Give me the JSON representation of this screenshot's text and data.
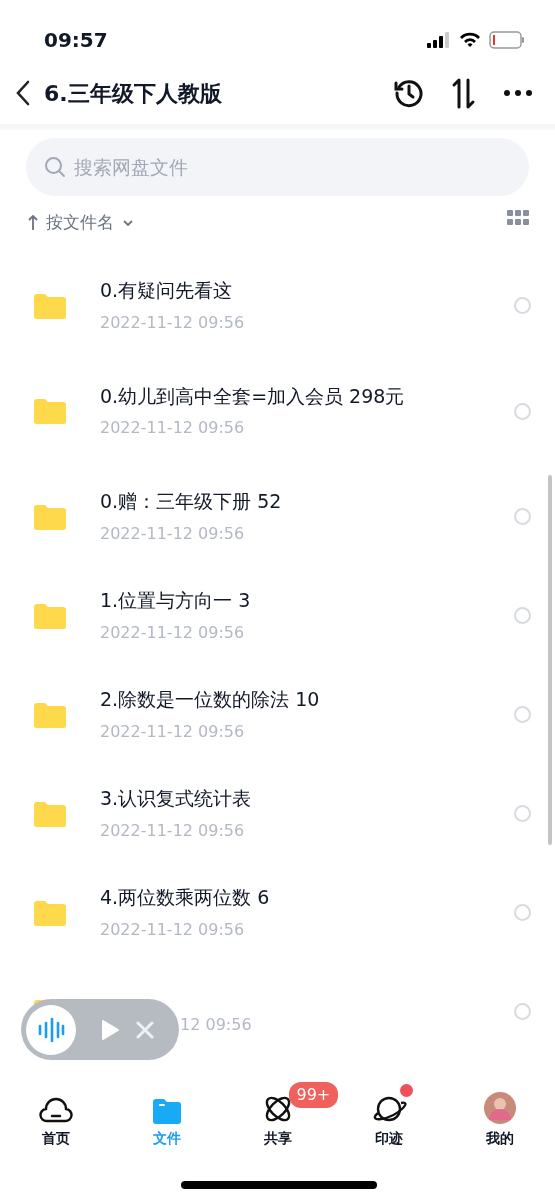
{
  "status_bar": {
    "time": "09:57"
  },
  "header": {
    "title": "6.三年级下人教版"
  },
  "search": {
    "placeholder": "搜索网盘文件"
  },
  "sort": {
    "label": "按文件名"
  },
  "files": [
    {
      "name": "0.有疑问先看这",
      "date": "2022-11-12 09:56",
      "selected": false
    },
    {
      "name": "0.幼儿到高中全套=加入会员 298元",
      "date": "2022-11-12 09:56",
      "selected": false
    },
    {
      "name": "0.赠：三年级下册 52",
      "date": "2022-11-12 09:56",
      "selected": false
    },
    {
      "name": "1.位置与方向一 3",
      "date": "2022-11-12 09:56",
      "selected": false
    },
    {
      "name": "2.除数是一位数的除法 10",
      "date": "2022-11-12 09:56",
      "selected": false
    },
    {
      "name": "3.认识复式统计表",
      "date": "2022-11-12 09:56",
      "selected": false
    },
    {
      "name": "4.两位数乘两位数 6",
      "date": "2022-11-12 09:56",
      "selected": false
    },
    {
      "date": "12 09:56",
      "selected": false
    }
  ],
  "tabs": [
    {
      "label": "首页",
      "selected": false
    },
    {
      "label": "文件",
      "selected": true
    },
    {
      "label": "共享",
      "selected": false,
      "badge": "99+"
    },
    {
      "label": "印迹",
      "selected": false,
      "dot": true
    },
    {
      "label": "我的",
      "selected": false
    }
  ]
}
